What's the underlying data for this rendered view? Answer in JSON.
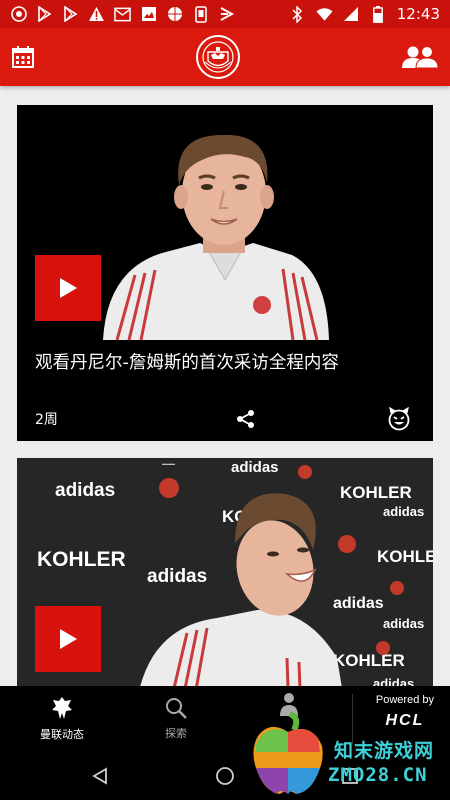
{
  "status_bar": {
    "time": "12:43",
    "left_icons": [
      "man-utd-icon",
      "play-store-icon",
      "play-store-icon",
      "warning-icon",
      "mail-icon",
      "image-icon",
      "ball-icon",
      "phone-icon",
      "delivery-icon"
    ],
    "right_icons": [
      "bluetooth-icon",
      "wifi-icon",
      "signal-icon",
      "battery-icon"
    ],
    "color": "#c8120b"
  },
  "app_bar": {
    "left_icon": "calendar-icon",
    "logo": "manchester-united-crest",
    "right_icon": "people-icon",
    "color": "#da1a0f"
  },
  "feed": {
    "cards": [
      {
        "title": "观看丹尼尔-詹姆斯的首次采访全程内容",
        "age": "2周",
        "share_icon": "share-icon",
        "reaction_icon": "devil-emoji-icon"
      },
      {
        "title": "",
        "age": ""
      }
    ]
  },
  "bottom_nav": {
    "items": [
      {
        "label": "曼联动态",
        "icon": "club-icon"
      },
      {
        "label": "探索",
        "icon": "search-icon"
      },
      {
        "label": "",
        "icon": "player-icon"
      }
    ],
    "powered_by": "Powered by",
    "sponsor": "HCL"
  },
  "watermark": {
    "text": "知末游戏网",
    "url": "ZMO28.CN"
  }
}
